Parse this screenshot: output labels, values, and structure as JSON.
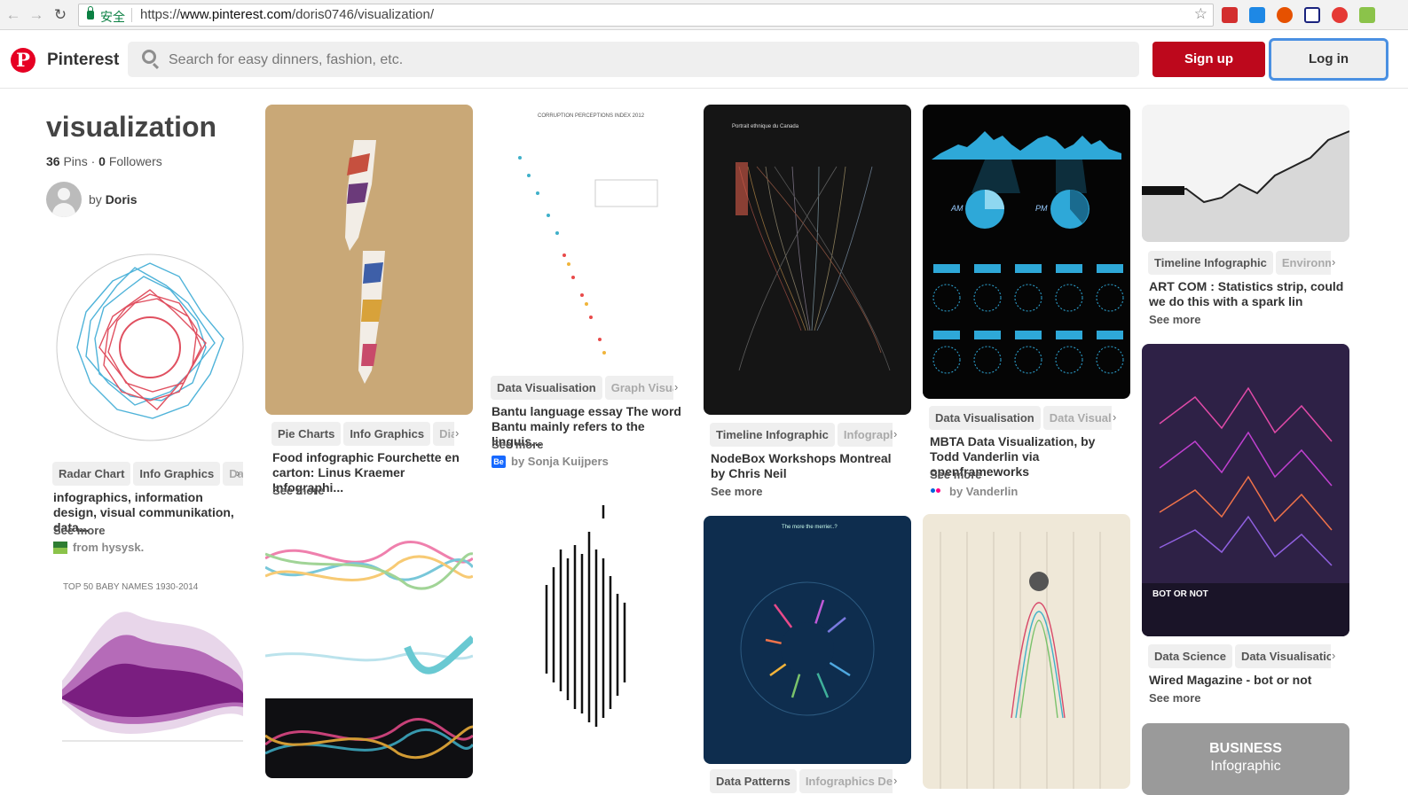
{
  "browser": {
    "secure_label": "安全",
    "url_prefix": "https://",
    "url_host": "www.pinterest.com",
    "url_path": "/doris0746/visualization/"
  },
  "header": {
    "brand": "Pinterest",
    "search_placeholder": "Search for easy dinners, fashion, etc.",
    "signup_label": "Sign up",
    "login_label": "Log in"
  },
  "board": {
    "title": "visualization",
    "pins_count": "36",
    "pins_label": "Pins",
    "followers_count": "0",
    "followers_label": "Followers",
    "by_prefix": "by",
    "owner": "Doris"
  },
  "pins": {
    "radar": {
      "tags": [
        "Radar Chart",
        "Info Graphics",
        "Da"
      ],
      "desc": "infographics, information design, visual communikation, data...",
      "see_more": "See more",
      "attrib": "from hysysk."
    },
    "babynames": {
      "chart_title": "TOP 50 BABY NAMES 1930-2014"
    },
    "food": {
      "tags": [
        "Pie Charts",
        "Info Graphics",
        "Diag"
      ],
      "desc": "Food infographic Fourchette en carton: Linus Kraemer Infographi...",
      "see_more": "See more"
    },
    "bantu": {
      "img_title": "CORRUPTION PERCEPTIONS INDEX 2012",
      "tags": [
        "Data Visualisation",
        "Graph Visuali"
      ],
      "desc": "Bantu language essay The word Bantu mainly refers to the linguis...",
      "see_more": "See more",
      "attrib": "by Sonja Kuijpers"
    },
    "nodebox": {
      "img_title": "Portrait ethnique du Canada",
      "tags": [
        "Timeline Infographic",
        "Infographi"
      ],
      "desc": "NodeBox Workshops Montreal by Chris Neil",
      "see_more": "See more"
    },
    "patterns": {
      "img_title": "The more the merrier..?",
      "tags": [
        "Data Patterns",
        "Infographics Desi"
      ]
    },
    "mbta": {
      "label_am": "AM",
      "label_pm": "PM",
      "tags": [
        "Data Visualisation",
        "Data Visualiz"
      ],
      "desc": "MBTA Data Visualization, by Todd Vanderlin via openframeworks",
      "see_more": "See more",
      "attrib": "by Vanderlin"
    },
    "artcom": {
      "tags": [
        "Timeline Infographic",
        "Environme"
      ],
      "desc": "ART COM : Statistics strip, could we do this with a spark lin",
      "see_more": "See more"
    },
    "wired": {
      "img_title": "BOT OR NOT",
      "tags": [
        "Data Science",
        "Data Visualisation"
      ],
      "desc": "Wired Magazine - bot or not",
      "see_more": "See more"
    },
    "business": {
      "line1": "BUSINESS",
      "line2": "Infographic"
    }
  },
  "colors": {
    "pinterest_red": "#bd081c",
    "focus_blue": "#4a90e2"
  }
}
